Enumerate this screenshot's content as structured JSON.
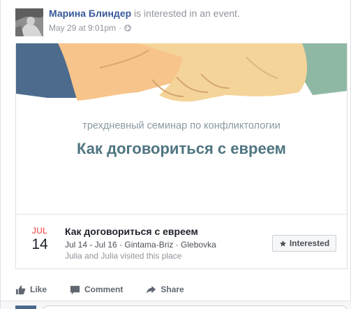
{
  "post": {
    "author": "Марина Блиндер",
    "action_text": "is interested in an event.",
    "timestamp": "May 29 at 9:01pm",
    "separator": "·",
    "privacy_icon": "globe-icon"
  },
  "event": {
    "cover_subtitle": "трехдневный семинар по конфликтологии",
    "cover_title": "Как договориться с евреем",
    "month": "JUL",
    "day": "14",
    "title": "Как договориться с евреем",
    "details": "Jul 14 - Jul 16 · Gintama-Briz · Glebovka",
    "visited": "Julia and Julia visited this place",
    "interested_label": "Interested",
    "interested_icon": "star-icon"
  },
  "actions": {
    "like": "Like",
    "comment": "Comment",
    "share": "Share"
  },
  "colors": {
    "author": "#365899",
    "month": "#ee3333",
    "handshake_left": "#f7c48b",
    "handshake_right": "#f5d49a",
    "sleeve_left": "#4d6b8d",
    "sleeve_right": "#8fb8a4"
  }
}
